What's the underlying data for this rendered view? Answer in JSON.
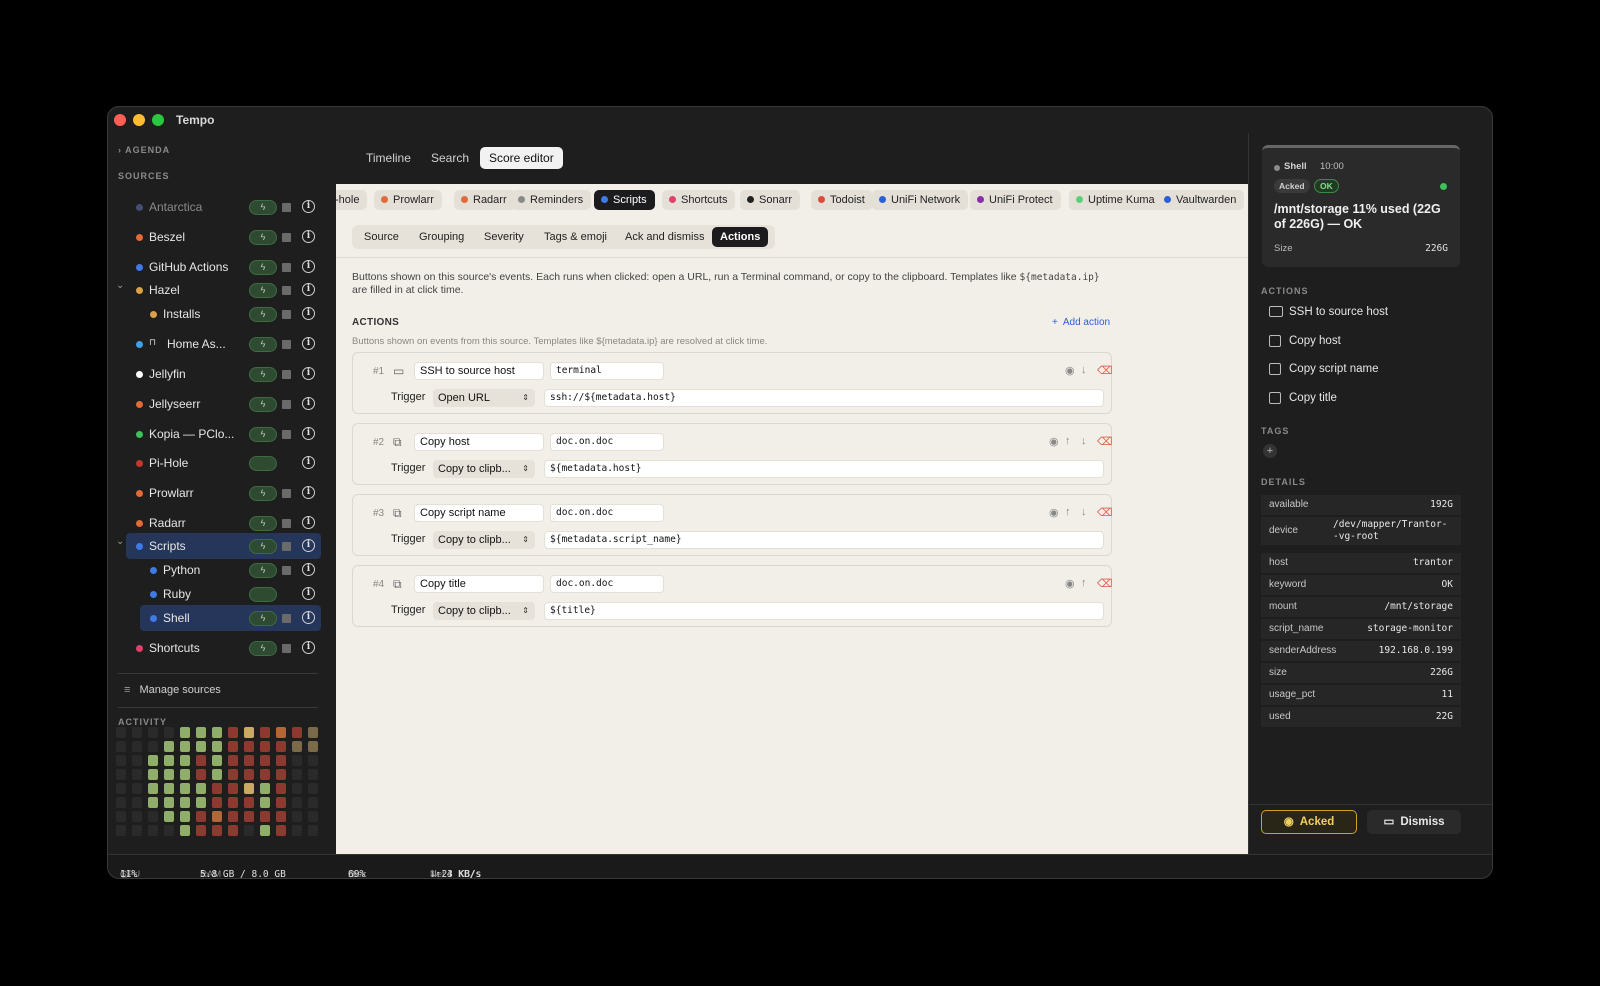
{
  "app": {
    "title": "Tempo"
  },
  "sidebar": {
    "agenda_label": "AGENDA",
    "sources_label": "SOURCES",
    "sources": [
      {
        "label": "Antarctica",
        "color": "#5a6fa8",
        "dim": true
      },
      {
        "label": "Beszel",
        "color": "#e06a3a"
      },
      {
        "label": "GitHub Actions",
        "color": "#3f7be6"
      },
      {
        "label": "Hazel",
        "color": "#d9a24a",
        "expanded": true
      },
      {
        "label": "Installs",
        "color": "#d9a24a",
        "child": true
      },
      {
        "label": "Home As...",
        "color": "#3fa0e6",
        "locked": true
      },
      {
        "label": "Jellyfin",
        "color": "#ffffff"
      },
      {
        "label": "Jellyseerr",
        "color": "#e06a3a"
      },
      {
        "label": "Kopia — PClo...",
        "color": "#3fc05a"
      },
      {
        "label": "Pi-Hole",
        "color": "#c0392b"
      },
      {
        "label": "Prowlarr",
        "color": "#e06a3a"
      },
      {
        "label": "Radarr",
        "color": "#e06a3a"
      },
      {
        "label": "Scripts",
        "color": "#3f7be6",
        "selected": true,
        "expanded": true
      },
      {
        "label": "Python",
        "color": "#3f7be6",
        "child": true
      },
      {
        "label": "Ruby",
        "color": "#3f7be6",
        "child": true
      },
      {
        "label": "Shell",
        "color": "#3f7be6",
        "child": true,
        "selected": true
      },
      {
        "label": "Shortcuts",
        "color": "#e0406a"
      }
    ],
    "manage_label": "Manage sources",
    "activity_label": "ACTIVITY"
  },
  "topbar": {
    "tabs": [
      "Timeline",
      "Search",
      "Score editor"
    ],
    "active": "Score editor"
  },
  "source_chips": [
    {
      "label": "-hole",
      "color": ""
    },
    {
      "label": "Prowlarr",
      "color": "#e06a3a"
    },
    {
      "label": "Radarr",
      "color": "#e06a3a"
    },
    {
      "label": "Reminders",
      "color": "#8a8a8a"
    },
    {
      "label": "Scripts",
      "color": "#3f7be6",
      "active": true
    },
    {
      "label": "Shortcuts",
      "color": "#e0406a"
    },
    {
      "label": "Sonarr",
      "color": "#222222"
    },
    {
      "label": "Todoist",
      "color": "#e04a3a"
    },
    {
      "label": "UniFi Network",
      "color": "#2d5fd4"
    },
    {
      "label": "UniFi Protect",
      "color": "#8a2da8"
    },
    {
      "label": "Uptime Kuma",
      "color": "#5ad07a"
    },
    {
      "label": "Vaultwarden",
      "color": "#2d5fd4"
    }
  ],
  "subtabs": {
    "items": [
      "Source",
      "Grouping",
      "Severity",
      "Tags & emoji",
      "Ack and dismiss",
      "Actions"
    ],
    "active": "Actions"
  },
  "description": {
    "text1": "Buttons shown on this source's events. Each runs when clicked: open a URL, run a Terminal command, or copy to the clipboard. Templates like ",
    "code": "${metadata.ip}",
    "text2": " are filled in at click time."
  },
  "actions_section": {
    "header": "ACTIONS",
    "add_label": "Add action",
    "subtitle": "Buttons shown on events from this source. Templates like ${metadata.ip} are resolved at click time.",
    "trigger_label": "Trigger",
    "items": [
      {
        "num": "#1",
        "icon": "terminal-icon",
        "name": "SSH to source host",
        "symbol": "terminal",
        "trigger": "Open URL",
        "template": "ssh://${metadata.host}"
      },
      {
        "num": "#2",
        "icon": "copy-icon",
        "name": "Copy host",
        "symbol": "doc.on.doc",
        "trigger": "Copy to clipb...",
        "template": "${metadata.host}"
      },
      {
        "num": "#3",
        "icon": "copy-icon",
        "name": "Copy script name",
        "symbol": "doc.on.doc",
        "trigger": "Copy to clipb...",
        "template": "${metadata.script_name}"
      },
      {
        "num": "#4",
        "icon": "copy-icon",
        "name": "Copy title",
        "symbol": "doc.on.doc",
        "trigger": "Copy to clipb...",
        "template": "${title}"
      }
    ]
  },
  "event": {
    "source": "Shell",
    "time": "10:00",
    "badge_acked": "Acked",
    "badge_ok": "OK",
    "title": "/mnt/storage 11% used (22G of 226G) — OK",
    "size_label": "Size",
    "size_value": "226G"
  },
  "right_panel": {
    "actions_label": "ACTIONS",
    "actions": [
      "SSH to source host",
      "Copy host",
      "Copy script name",
      "Copy title"
    ],
    "tags_label": "TAGS",
    "details_label": "DETAILS",
    "details": [
      {
        "k": "available",
        "v": "192G"
      },
      {
        "k": "device",
        "v": "/dev/mapper/Trantor--vg-root"
      },
      {
        "k": "host",
        "v": "trantor"
      },
      {
        "k": "keyword",
        "v": "OK"
      },
      {
        "k": "mount",
        "v": "/mnt/storage"
      },
      {
        "k": "script_name",
        "v": "storage-monitor"
      },
      {
        "k": "senderAddress",
        "v": "192.168.0.199"
      },
      {
        "k": "size",
        "v": "226G"
      },
      {
        "k": "usage_pct",
        "v": "11"
      },
      {
        "k": "used",
        "v": "22G"
      }
    ],
    "acked_button": "Acked",
    "dismiss_button": "Dismiss"
  },
  "statusbar": {
    "cpu_label": "CPU",
    "cpu_value": "11%",
    "ram_label": "RAM",
    "ram_value": "5.8 GB / 8.0 GB",
    "disk_label": "Disk",
    "disk_value": "69%",
    "net_label": "Net",
    "net_down": "↓ 23 KB/s",
    "net_up": "↑ 4 KB/s"
  }
}
